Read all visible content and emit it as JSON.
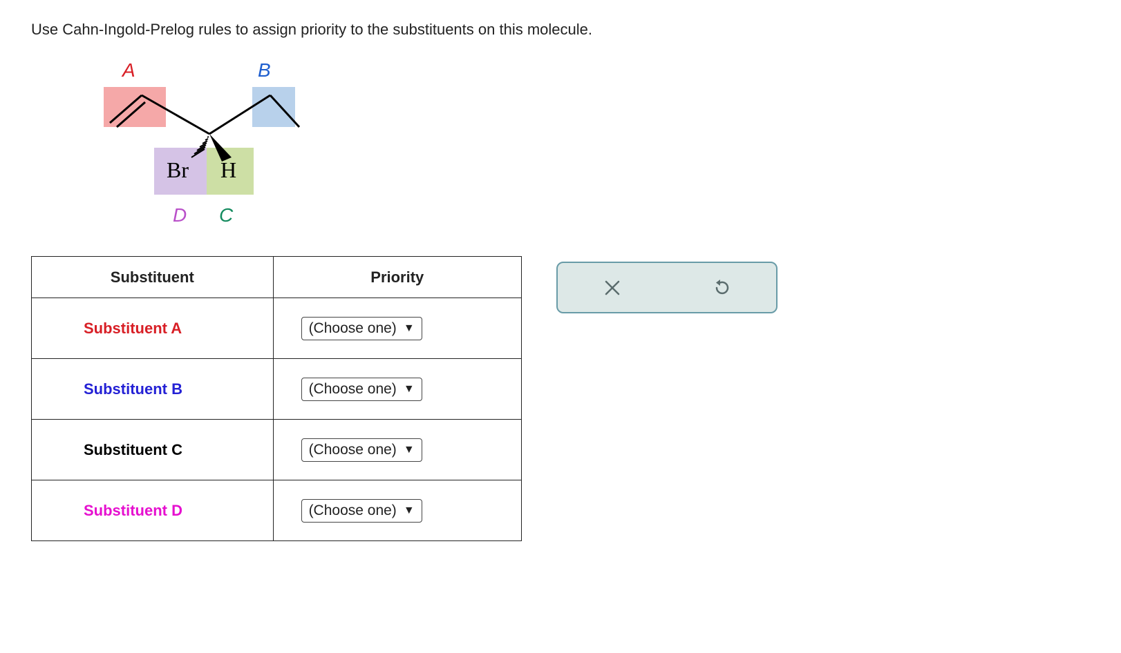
{
  "question": "Use Cahn-Ingold-Prelog rules to assign priority to the substituents on this molecule.",
  "molecule": {
    "labels": {
      "a": "A",
      "b": "B",
      "c": "C",
      "d": "D"
    },
    "atoms": {
      "br": "Br",
      "h": "H"
    }
  },
  "table": {
    "headers": {
      "substituent": "Substituent",
      "priority": "Priority"
    },
    "rows": [
      {
        "label": "Substituent A",
        "dropdown": "(Choose one)"
      },
      {
        "label": "Substituent B",
        "dropdown": "(Choose one)"
      },
      {
        "label": "Substituent C",
        "dropdown": "(Choose one)"
      },
      {
        "label": "Substituent D",
        "dropdown": "(Choose one)"
      }
    ]
  },
  "tools": {
    "clear": "clear-icon",
    "reset": "reset-icon"
  }
}
